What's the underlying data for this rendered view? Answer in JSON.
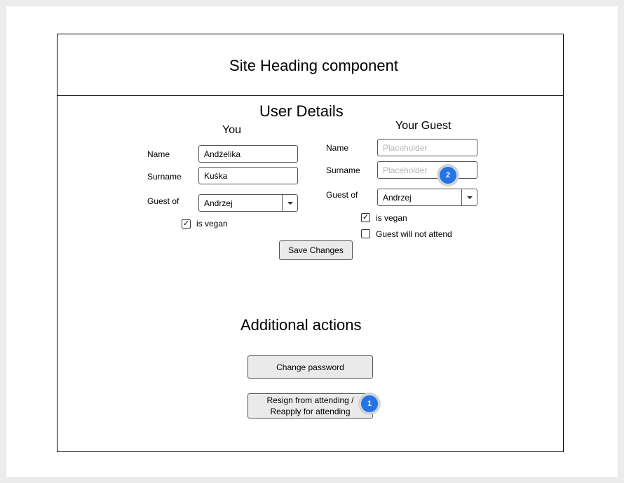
{
  "site_heading": "Site Heading component",
  "user_details": {
    "title": "User Details",
    "you": {
      "title": "You",
      "name_label": "Name",
      "name_value": "Andżelika",
      "surname_label": "Surname",
      "surname_value": "Kuśka",
      "guest_of_label": "Guest of",
      "guest_of_value": "Andrzej",
      "vegan_label": "is vegan",
      "vegan_checked": true
    },
    "guest": {
      "title": "Your Guest",
      "name_label": "Name",
      "name_placeholder": "Placeholder",
      "surname_label": "Surname",
      "surname_placeholder": "Placeholder",
      "guest_of_label": "Guest of",
      "guest_of_value": "Andrzej",
      "vegan_label": "is vegan",
      "vegan_checked": true,
      "not_attend_label": "Guest will not attend",
      "not_attend_checked": false
    },
    "save_label": "Save Changes"
  },
  "additional": {
    "title": "Additional actions",
    "change_password_label": "Change password",
    "resign_line1": "Resign from attending /",
    "resign_line2": "Reapply for attending"
  },
  "badges": {
    "badge1": "1",
    "badge2": "2"
  },
  "colors": {
    "badge_blue": "#2573e6",
    "badge_ring": "#cfd3d8",
    "button_bg": "#eaeaea"
  }
}
